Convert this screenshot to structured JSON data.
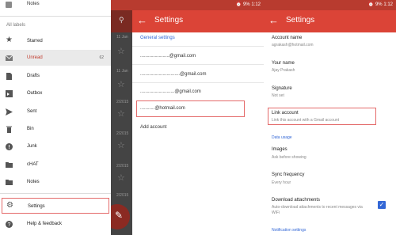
{
  "drawer": {
    "top_item": "Notes",
    "all_labels": "All labels",
    "items": [
      {
        "label": "Starred",
        "count": ""
      },
      {
        "label": "Unread",
        "count": "62"
      },
      {
        "label": "Drafts",
        "count": ""
      },
      {
        "label": "Outbox",
        "count": ""
      },
      {
        "label": "Sent",
        "count": ""
      },
      {
        "label": "Bin",
        "count": ""
      },
      {
        "label": "Junk",
        "count": ""
      },
      {
        "label": "cHAT",
        "count": ""
      },
      {
        "label": "Notes",
        "count": ""
      },
      {
        "label": "Settings",
        "count": ""
      },
      {
        "label": "Help & feedback",
        "count": ""
      }
    ],
    "background_dates": [
      "11 Jan",
      "11 Jan",
      "2/2015",
      "2/2015",
      "2/2015",
      "2/2015"
    ]
  },
  "status_bar": {
    "battery": "9%",
    "time": "1:12"
  },
  "settings_list": {
    "title": "Settings",
    "general_header": "General settings",
    "accounts": [
      "......................@gmail.com",
      "..............................@gmail.com",
      "..........................@gmail.com",
      "...........@hotmail.com"
    ],
    "add_account": "Add account"
  },
  "account_settings": {
    "title": "Settings",
    "items": [
      {
        "title": "Account name",
        "subtitle": "agrakash@hotmail.com"
      },
      {
        "title": "Your name",
        "subtitle": "Ajay Prakash"
      },
      {
        "title": "Signature",
        "subtitle": "Not set"
      },
      {
        "title": "Link account",
        "subtitle": "Link this account with a Gmail account"
      }
    ],
    "data_usage_header": "Data usage",
    "data_items": [
      {
        "title": "Images",
        "subtitle": "Ask before showing"
      },
      {
        "title": "Sync frequency",
        "subtitle": "Every hour"
      },
      {
        "title": "Download attachments",
        "subtitle": "Auto-download attachments to recent messages via WiFi"
      }
    ],
    "notification_header": "Notification settings"
  },
  "colors": {
    "accent": "#db4437",
    "status": "#b83b2f",
    "link": "#3367d6",
    "highlight_border": "#e46a6a"
  }
}
